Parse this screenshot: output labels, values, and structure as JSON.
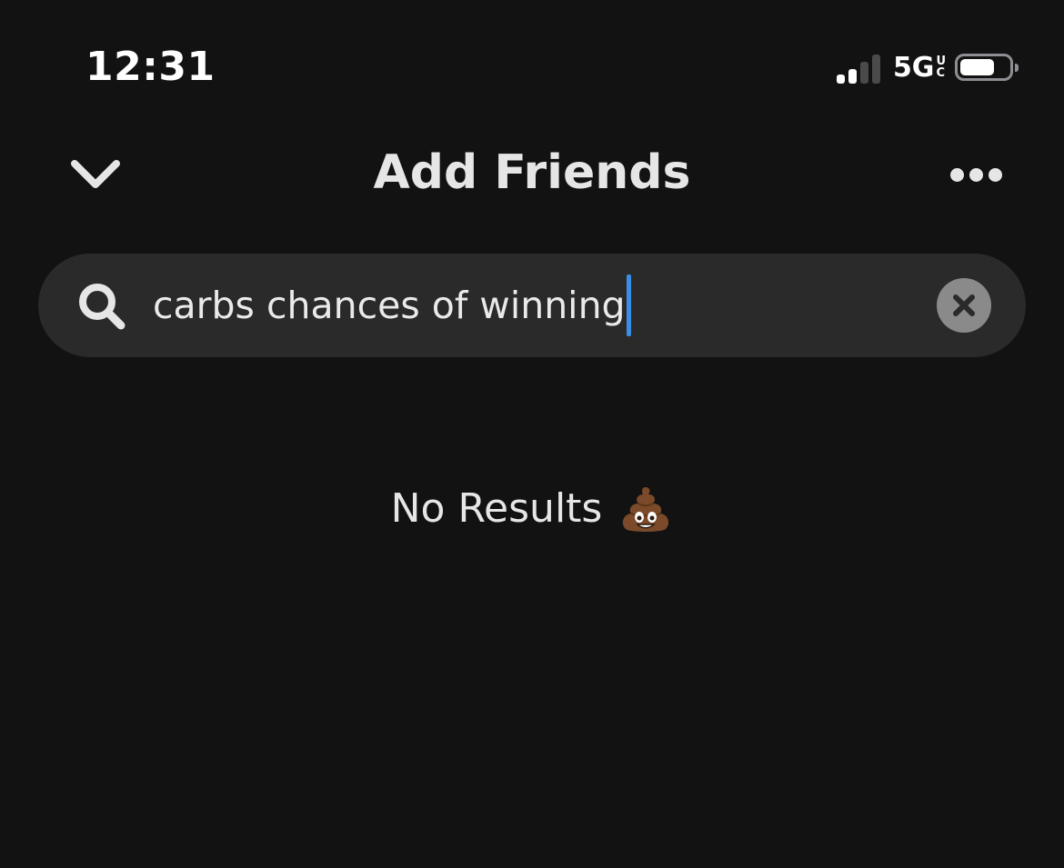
{
  "status_bar": {
    "time": "12:31",
    "network": "5G",
    "network_sup_top": "U",
    "network_sup_bottom": "C",
    "signal_bars_active": 2,
    "signal_bars_total": 4,
    "battery_level": 0.72
  },
  "header": {
    "back_icon": "chevron-down-icon",
    "title": "Add Friends",
    "more_icon": "more-horizontal-icon"
  },
  "search": {
    "icon": "search-icon",
    "value": "carbs chances of winning",
    "clear_icon": "clear-circle-icon"
  },
  "empty_state": {
    "text": "No Results",
    "emoji_icon": "poop-emoji-icon"
  },
  "colors": {
    "background": "#121212",
    "search_background": "#2a2a2a",
    "caret": "#3a8ee6",
    "clear_button": "#8a8a8a"
  }
}
